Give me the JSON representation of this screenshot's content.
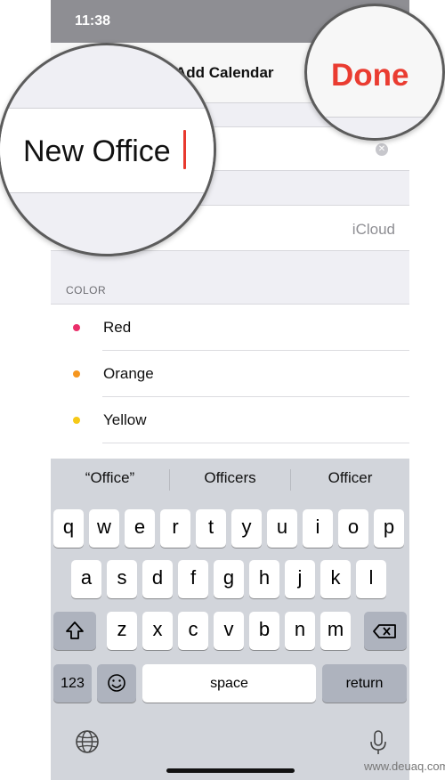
{
  "status_bar": {
    "time": "11:38"
  },
  "nav": {
    "title": "Add Calendar",
    "done_label": "Done"
  },
  "name_field": {
    "value": "New Office"
  },
  "account": {
    "value": "iCloud"
  },
  "colors": {
    "header": "COLOR",
    "items": [
      {
        "label": "Red",
        "color": "#ea2f6a"
      },
      {
        "label": "Orange",
        "color": "#f5961f"
      },
      {
        "label": "Yellow",
        "color": "#f6c917"
      }
    ]
  },
  "keyboard": {
    "suggestions": [
      "“Office”",
      "Officers",
      "Officer"
    ],
    "row1": [
      "q",
      "w",
      "e",
      "r",
      "t",
      "y",
      "u",
      "i",
      "o",
      "p"
    ],
    "row2": [
      "a",
      "s",
      "d",
      "f",
      "g",
      "h",
      "j",
      "k",
      "l"
    ],
    "row3": [
      "z",
      "x",
      "c",
      "v",
      "b",
      "n",
      "m"
    ],
    "numbers_label": "123",
    "space_label": "space",
    "return_label": "return"
  },
  "watermark": "www.deuaq.com"
}
